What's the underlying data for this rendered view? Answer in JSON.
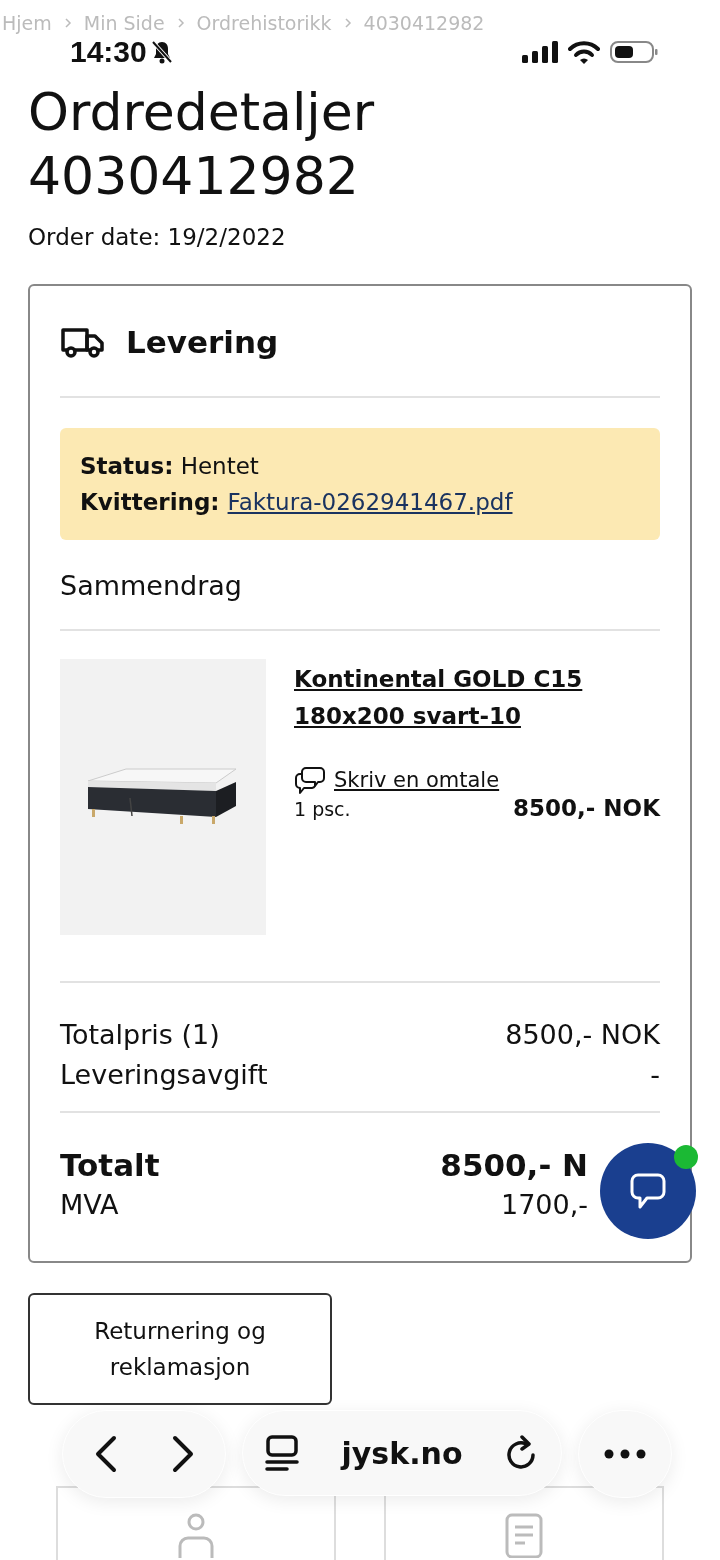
{
  "breadcrumb": [
    "Hjem",
    "Min Side",
    "Ordrehistorikk",
    "4030412982"
  ],
  "status_bar": {
    "time": "14:30"
  },
  "title": "Ordredetaljer 4030412982",
  "order_date": "Order date: 19/2/2022",
  "delivery": {
    "heading": "Levering",
    "status": "**Status:** Hentet",
    "receipt": {
      "label": "Kvittering:",
      "link": "Faktura-0262941467.pdf"
    },
    "summary_heading": "Sammendrag",
    "items": [
      {
        "name": "Kontinental GOLD C15 180x200 svart-10",
        "review_link": "Skriv en omtale",
        "quantity": "1 psc.",
        "price": "8500,- NOK"
      }
    ],
    "totals": [
      [
        {
          "label": "Totalpris (1)",
          "value": "8500,- NOK",
          "kind": "regular"
        },
        {
          "label": "Leveringsavgift",
          "value": "-",
          "kind": "regular"
        }
      ],
      [
        {
          "label": "Totalt",
          "value": "8500,- N",
          "kind": "grand"
        },
        {
          "label": "MVA",
          "value": "1700,-",
          "kind": "regular"
        }
      ]
    ]
  },
  "return_button": "Returnering og reklamasjon",
  "chat_button": {
    "unread": true
  },
  "browser_bar": {
    "url": "jysk.no"
  }
}
